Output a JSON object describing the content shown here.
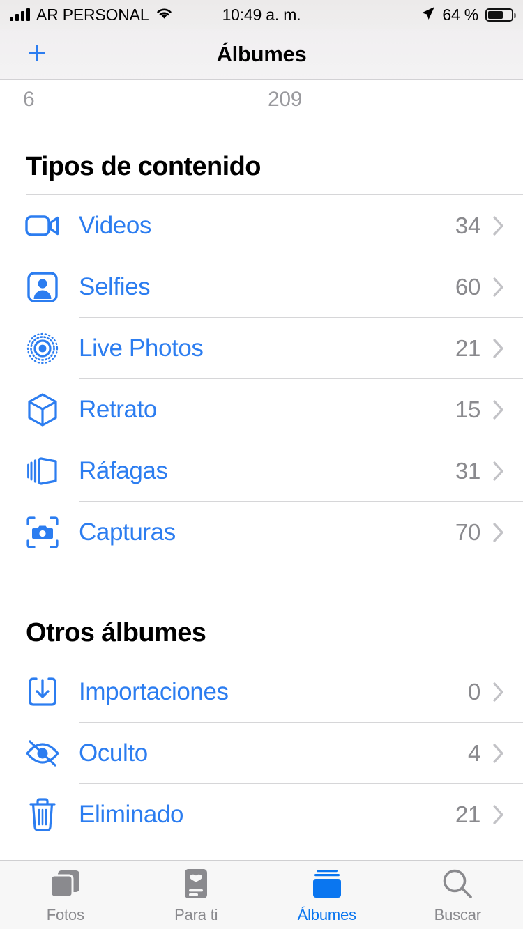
{
  "status_bar": {
    "carrier": "AR PERSONAL",
    "time": "10:49 a. m.",
    "battery_percent": "64 %",
    "battery_level": 64,
    "signal_icon": "cellular-signal-icon",
    "wifi_icon": "wifi-icon",
    "location_icon": "location-arrow-icon",
    "battery_icon": "battery-icon"
  },
  "nav": {
    "add_icon": "plus-icon",
    "title": "Álbumes"
  },
  "peek": {
    "count_left": "6",
    "count_right": "209"
  },
  "sections": [
    {
      "title": "Tipos de contenido",
      "rows": [
        {
          "label": "Videos",
          "count": "34",
          "icon": "video-camera-icon"
        },
        {
          "label": "Selfies",
          "count": "60",
          "icon": "selfie-person-icon"
        },
        {
          "label": "Live Photos",
          "count": "21",
          "icon": "live-photo-icon"
        },
        {
          "label": "Retrato",
          "count": "15",
          "icon": "cube-icon"
        },
        {
          "label": "Ráfagas",
          "count": "31",
          "icon": "burst-stack-icon"
        },
        {
          "label": "Capturas",
          "count": "70",
          "icon": "screenshot-camera-icon"
        }
      ]
    },
    {
      "title": "Otros álbumes",
      "rows": [
        {
          "label": "Importaciones",
          "count": "0",
          "icon": "import-download-icon"
        },
        {
          "label": "Oculto",
          "count": "4",
          "icon": "eye-slash-icon"
        },
        {
          "label": "Eliminado",
          "count": "21",
          "icon": "trash-icon"
        }
      ]
    }
  ],
  "tabbar": {
    "items": [
      {
        "label": "Fotos",
        "icon": "photos-stack-icon",
        "active": false
      },
      {
        "label": "Para ti",
        "icon": "for-you-card-icon",
        "active": false
      },
      {
        "label": "Álbumes",
        "icon": "albums-icon",
        "active": true
      },
      {
        "label": "Buscar",
        "icon": "search-icon",
        "active": false
      }
    ]
  },
  "colors": {
    "accent": "#2c7df0",
    "tab_active": "#0a76f0",
    "secondary_text": "#8a8a8e"
  }
}
